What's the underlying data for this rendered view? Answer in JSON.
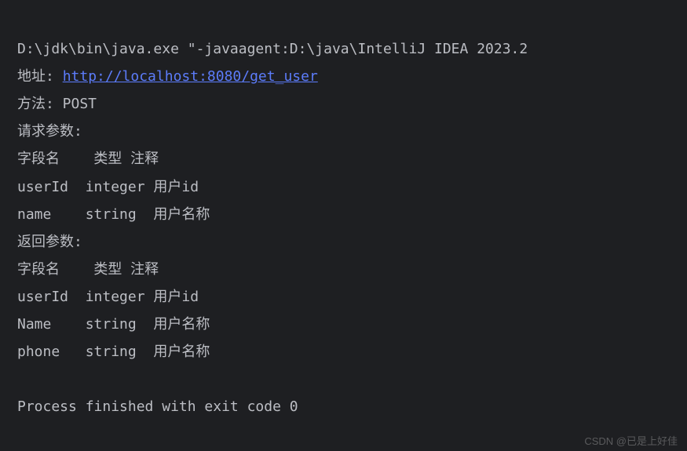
{
  "console": {
    "command_line": "D:\\jdk\\bin\\java.exe \"-javaagent:D:\\java\\IntelliJ IDEA 2023.2",
    "address_label": "地址: ",
    "address_url": "http://localhost:8080/get_user",
    "method_line": "方法: POST",
    "request_params_header": "请求参数:",
    "request_table_header": "字段名    类型 注释",
    "request_rows": [
      "userId  integer 用户id",
      "name    string  用户名称"
    ],
    "response_params_header": "返回参数:",
    "response_table_header": "字段名    类型 注释",
    "response_rows": [
      "userId  integer 用户id",
      "Name    string  用户名称",
      "phone   string  用户名称"
    ],
    "process_finished": "Process finished with exit code 0"
  },
  "watermark": "CSDN @已是上好佳"
}
